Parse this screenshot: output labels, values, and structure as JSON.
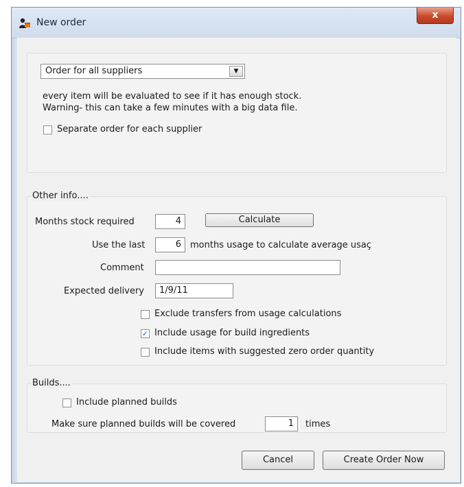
{
  "window": {
    "title": "New order",
    "close_label": "x"
  },
  "supplier_section": {
    "dropdown_value": "Order for all suppliers",
    "info_line1": "every item will be evaluated to see if it has enough stock.",
    "info_line2": "Warning- this can take a few minutes with a big data file.",
    "separate_order_label": "Separate order for each supplier",
    "separate_order_checked": false
  },
  "other_info": {
    "group_label": "Other info....",
    "months_label": "Months stock required",
    "months_value": "4",
    "calculate_label": "Calculate",
    "use_last_label": "Use the last",
    "use_last_value": "6",
    "use_last_suffix": "months usage to calculate average usaç",
    "comment_label": "Comment",
    "comment_value": "",
    "expected_delivery_label": "Expected delivery",
    "expected_delivery_value": "1/9/11",
    "exclude_transfers_label": "Exclude transfers from usage calculations",
    "exclude_transfers_checked": false,
    "include_build_label": "Include usage for build ingredients",
    "include_build_checked": true,
    "include_zero_label": "Include items with suggested zero order quantity",
    "include_zero_checked": false
  },
  "builds": {
    "group_label": "Builds....",
    "include_planned_label": "Include planned builds",
    "include_planned_checked": false,
    "make_sure_label": "Make sure planned builds will be covered",
    "times_value": "1",
    "times_label": "times"
  },
  "footer": {
    "cancel_label": "Cancel",
    "create_label": "Create Order Now"
  }
}
